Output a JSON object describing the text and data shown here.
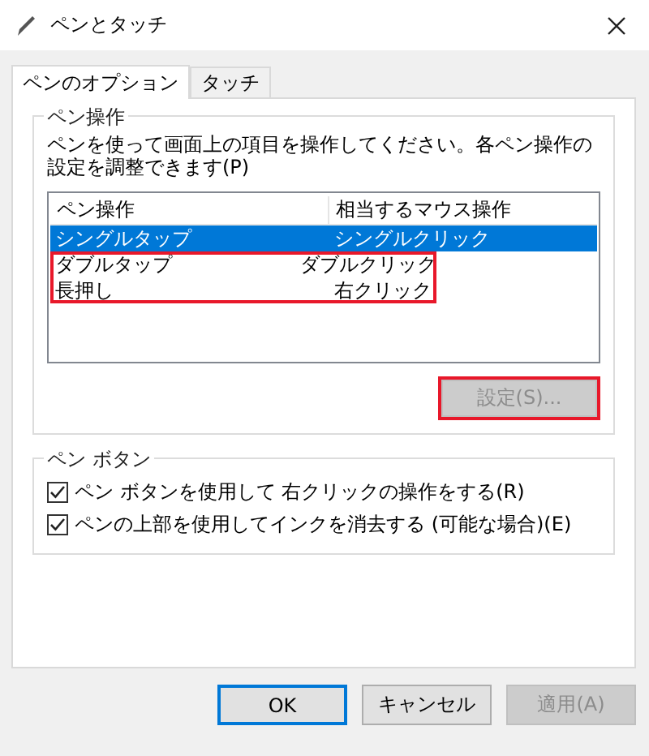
{
  "window": {
    "title": "ペンとタッチ"
  },
  "tabs": [
    {
      "label": "ペンのオプション",
      "selected": true
    },
    {
      "label": "タッチ",
      "selected": false
    }
  ],
  "pen_actions": {
    "title": "ペン操作",
    "description": "ペンを使って画面上の項目を操作してください。各ペン操作の設定を調整できます(P)",
    "columns": [
      "ペン操作",
      "相当するマウス操作"
    ],
    "rows": [
      {
        "cells": [
          "シングルタップ",
          "シングルクリック"
        ],
        "selected": true,
        "highlighted": false
      },
      {
        "cells": [
          "ダブルタップ",
          "ダブルクリック"
        ],
        "selected": false,
        "highlighted": true
      },
      {
        "cells": [
          "長押し",
          "右クリック"
        ],
        "selected": false,
        "highlighted": true
      }
    ],
    "settings_button": {
      "label": "設定(S)...",
      "disabled": true,
      "highlighted": true
    }
  },
  "pen_buttons": {
    "title": "ペン ボタン",
    "options": [
      {
        "label": "ペン ボタンを使用して 右クリックの操作をする(R)",
        "checked": true
      },
      {
        "label": "ペンの上部を使用してインクを消去する (可能な場合)(E)",
        "checked": true
      }
    ]
  },
  "buttons": [
    {
      "label": "OK",
      "default": true,
      "disabled": false
    },
    {
      "label": "キャンセル",
      "default": false,
      "disabled": false
    },
    {
      "label": "適用(A)",
      "default": false,
      "disabled": true
    }
  ]
}
